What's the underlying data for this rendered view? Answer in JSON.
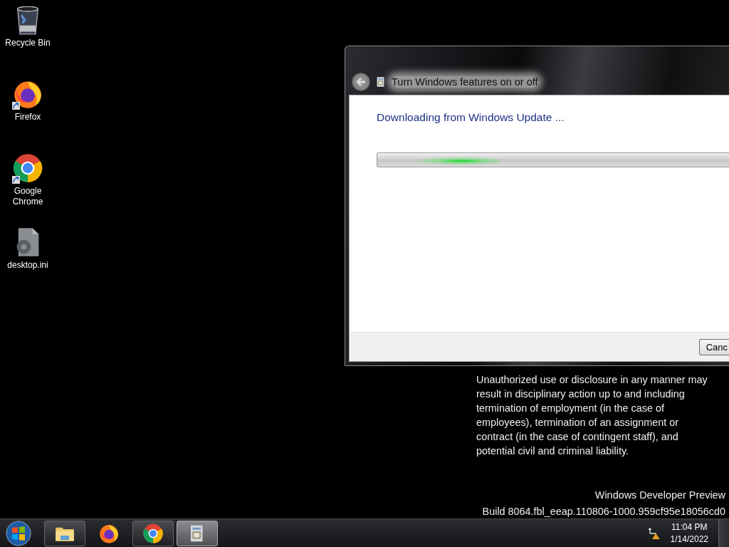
{
  "desktop_icons": [
    {
      "label": "Recycle Bin",
      "kind": "bin",
      "shortcut": false
    },
    {
      "label": "Firefox",
      "kind": "firefox",
      "shortcut": true
    },
    {
      "label": "Google Chrome",
      "kind": "chrome",
      "shortcut": true
    },
    {
      "label": "desktop.ini",
      "kind": "file",
      "shortcut": false
    }
  ],
  "window": {
    "title": "Turn Windows features on or off",
    "heading": "Downloading from Windows Update ...",
    "progress": {
      "level": 0.35
    },
    "buttons": [
      "Canc"
    ]
  },
  "watermark": {
    "legal": "Unauthorized use or disclosure in any manner may result in disciplinary action up to and including termination of employment (in the case of employees), termination of an assignment or contract (in the case of contingent staff), and potential civil and criminal liability.",
    "edition": "Windows Developer Preview",
    "build": "Build 8064.fbl_eeap.110806-1000.959cf95e18056cd0"
  },
  "taskbar": {
    "items": [
      {
        "kind": "explorer",
        "running": true,
        "selected": false
      },
      {
        "kind": "firefox",
        "running": false,
        "selected": false
      },
      {
        "kind": "chrome",
        "running": true,
        "selected": false
      },
      {
        "kind": "features",
        "running": true,
        "selected": true
      }
    ],
    "clock": {
      "time": "11:04 PM",
      "date": "1/14/2022"
    }
  }
}
